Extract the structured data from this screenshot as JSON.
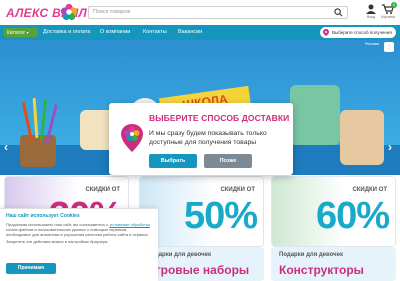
{
  "header": {
    "logo_text": "АЛЕКС ВИЛЛ",
    "search_placeholder": "Поиск товаров",
    "login_label": "Вход",
    "cart_label": "Корзина",
    "cart_count": "0"
  },
  "nav": {
    "catalog_label": "Каталог",
    "items": [
      "Доставка и оплата",
      "О компании",
      "Контакты",
      "Вакансии"
    ],
    "pickup_label": "Выберите способ получения"
  },
  "banner": {
    "ribbon_text": "ШКОЛА",
    "ad_label": "Реклама",
    "slides": 5,
    "active_slide": 3
  },
  "discounts": [
    {
      "label_line1": "СКИДКИ ОТ",
      "value": "30%",
      "color": "#19a9c9"
    },
    {
      "label_line1": "СКИДКИ ОТ",
      "value": "50%",
      "color": "#19a9c9"
    },
    {
      "label_line1": "СКИДКИ ОТ",
      "value": "60%",
      "color": "#19a9c9"
    }
  ],
  "promos": [
    {
      "title": "Подарки для девочек",
      "big": "Игровые наборы"
    },
    {
      "title": "Подарки для девочек",
      "big": "Конструкторы"
    }
  ],
  "cookie": {
    "title": "Наш сайт использует Cookies",
    "text1": "Продолжая использовать наш сайт, вы соглашаетесь с",
    "link": "условиями обработки",
    "text2": "cookie-файлов и пользовательских данных с помощью сервисов, необходимых для аналитики и улучшения качества работы сайта и сервиса.",
    "text3": "Запретить эти действия можно в настройках браузера.",
    "accept_label": "Принимаю"
  },
  "modal": {
    "title": "ВЫБЕРИТЕ СПОСОБ ДОСТАВКИ",
    "text": "И мы сразу будем показывать только доступные для получения товары",
    "choose_label": "Выбрать",
    "later_label": "Позже"
  },
  "colors": {
    "brand_blue": "#1596bf",
    "brand_pink": "#cb2e7e",
    "catalog_green": "#5aa13a",
    "button_gray": "#7c8a96"
  }
}
